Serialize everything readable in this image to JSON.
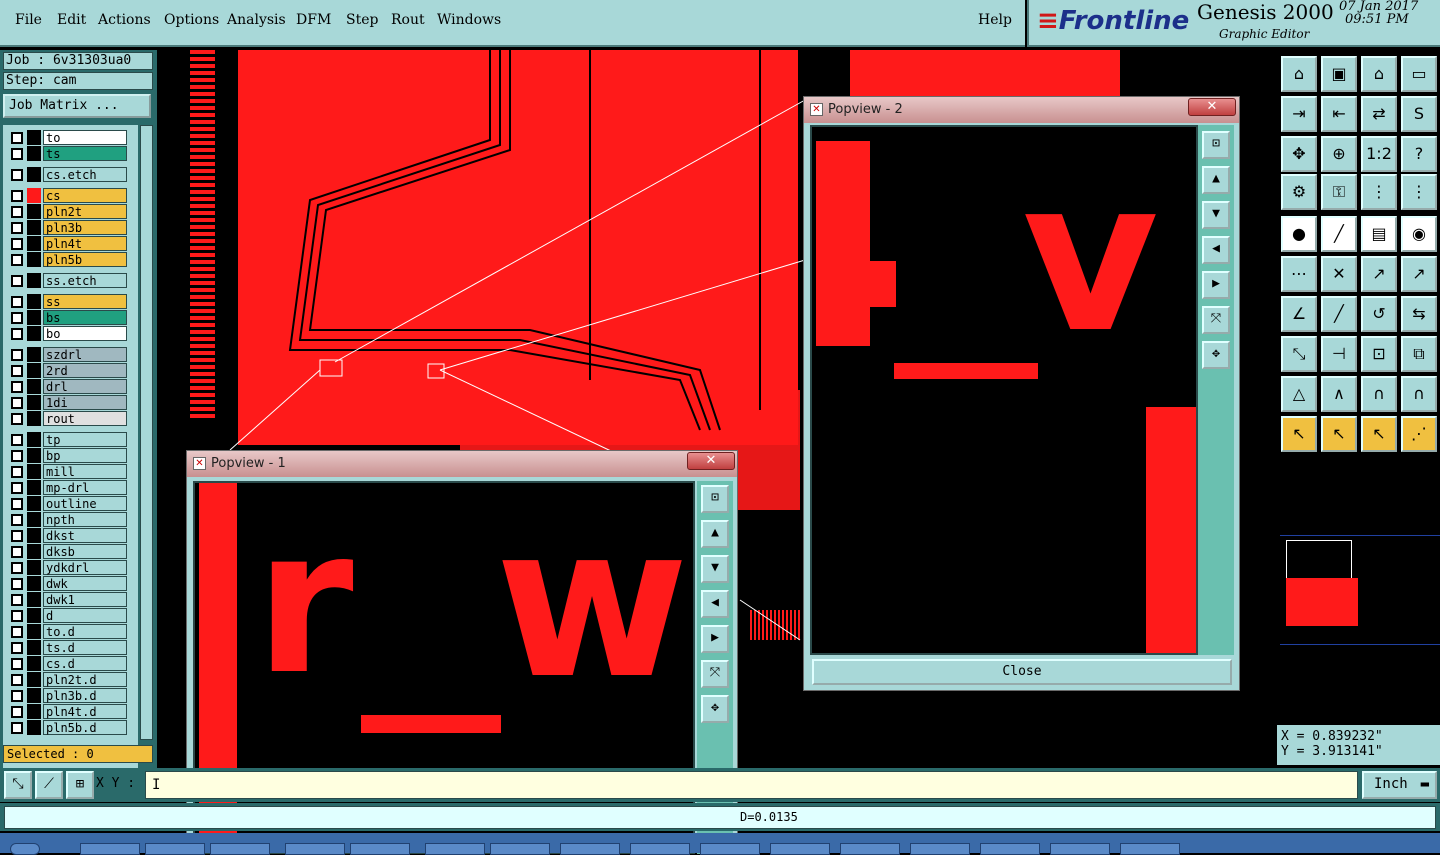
{
  "menubar": {
    "items": [
      "File",
      "Edit",
      "Actions",
      "Options",
      "Analysis",
      "DFM",
      "Step",
      "Rout",
      "Windows"
    ],
    "help": "Help"
  },
  "brand": {
    "logo": "Frontline",
    "app": "Genesis 2000",
    "subtitle": "Graphic Editor",
    "date": "07 Jan 2017",
    "time": "09:51 PM"
  },
  "job": {
    "job_line": "Job : 6v31303ua0",
    "step_line": "Step: cam",
    "matrix_button": "Job Matrix ..."
  },
  "layers": [
    {
      "name": "to",
      "color": "#ffffff",
      "sw": "#000000"
    },
    {
      "name": "ts",
      "color": "#20a080",
      "sw": "#000000"
    },
    {
      "name": "cs.etch",
      "color": "#a8d8d8",
      "sw": "#000000"
    },
    {
      "name": "cs",
      "color": "#f0c040",
      "sw": "#ff1a1a"
    },
    {
      "name": "pln2t",
      "color": "#f0c040",
      "sw": "#000000"
    },
    {
      "name": "pln3b",
      "color": "#f0c040",
      "sw": "#000000"
    },
    {
      "name": "pln4t",
      "color": "#f0c040",
      "sw": "#000000"
    },
    {
      "name": "pln5b",
      "color": "#f0c040",
      "sw": "#000000"
    },
    {
      "name": "ss.etch",
      "color": "#a8d8d8",
      "sw": "#000000"
    },
    {
      "name": "ss",
      "color": "#f0c040",
      "sw": "#000000"
    },
    {
      "name": "bs",
      "color": "#20a080",
      "sw": "#000000"
    },
    {
      "name": "bo",
      "color": "#ffffff",
      "sw": "#000000"
    },
    {
      "name": "szdrl",
      "color": "#a0b8c0",
      "sw": "#000000"
    },
    {
      "name": "2rd",
      "color": "#a0b8c0",
      "sw": "#000000"
    },
    {
      "name": "drl",
      "color": "#a0b8c0",
      "sw": "#000000"
    },
    {
      "name": "1di",
      "color": "#a0b8c0",
      "sw": "#000000"
    },
    {
      "name": "rout",
      "color": "#e0e0e0",
      "sw": "#000000"
    },
    {
      "name": "tp",
      "color": "#a8d8d8",
      "sw": "#000000"
    },
    {
      "name": "bp",
      "color": "#a8d8d8",
      "sw": "#000000"
    },
    {
      "name": "mill",
      "color": "#a8d8d8",
      "sw": "#000000"
    },
    {
      "name": "mp-drl",
      "color": "#a8d8d8",
      "sw": "#000000"
    },
    {
      "name": "outline",
      "color": "#a8d8d8",
      "sw": "#000000"
    },
    {
      "name": "npth",
      "color": "#a8d8d8",
      "sw": "#000000"
    },
    {
      "name": "dkst",
      "color": "#a8d8d8",
      "sw": "#000000"
    },
    {
      "name": "dksb",
      "color": "#a8d8d8",
      "sw": "#000000"
    },
    {
      "name": "ydkdrl",
      "color": "#a8d8d8",
      "sw": "#000000"
    },
    {
      "name": "dwk",
      "color": "#a8d8d8",
      "sw": "#000000"
    },
    {
      "name": "dwk1",
      "color": "#a8d8d8",
      "sw": "#000000"
    },
    {
      "name": "d",
      "color": "#a8d8d8",
      "sw": "#000000"
    },
    {
      "name": "to.d",
      "color": "#a8d8d8",
      "sw": "#000000"
    },
    {
      "name": "ts.d",
      "color": "#a8d8d8",
      "sw": "#000000"
    },
    {
      "name": "cs.d",
      "color": "#a8d8d8",
      "sw": "#000000"
    },
    {
      "name": "pln2t.d",
      "color": "#a8d8d8",
      "sw": "#000000"
    },
    {
      "name": "pln3b.d",
      "color": "#a8d8d8",
      "sw": "#000000"
    },
    {
      "name": "pln4t.d",
      "color": "#a8d8d8",
      "sw": "#000000"
    },
    {
      "name": "pln5b.d",
      "color": "#a8d8d8",
      "sw": "#000000"
    }
  ],
  "selected": "Selected : 0",
  "popview1": {
    "title": "Popview - 1",
    "close_x": "✕",
    "text_top": "r_w"
  },
  "popview2": {
    "title": "Popview - 2",
    "close_x": "✕",
    "close_button": "Close",
    "text_top": "4_v"
  },
  "coords": {
    "x": "X = 0.839232\"",
    "y": "Y = 3.913141\""
  },
  "input": {
    "label": "X Y :",
    "value": "I"
  },
  "unit": "Inch",
  "status": "D=0.0135",
  "colors": {
    "copper": "#ff1a1a",
    "panel": "#a8d8d8",
    "accent": "#f0c040"
  }
}
